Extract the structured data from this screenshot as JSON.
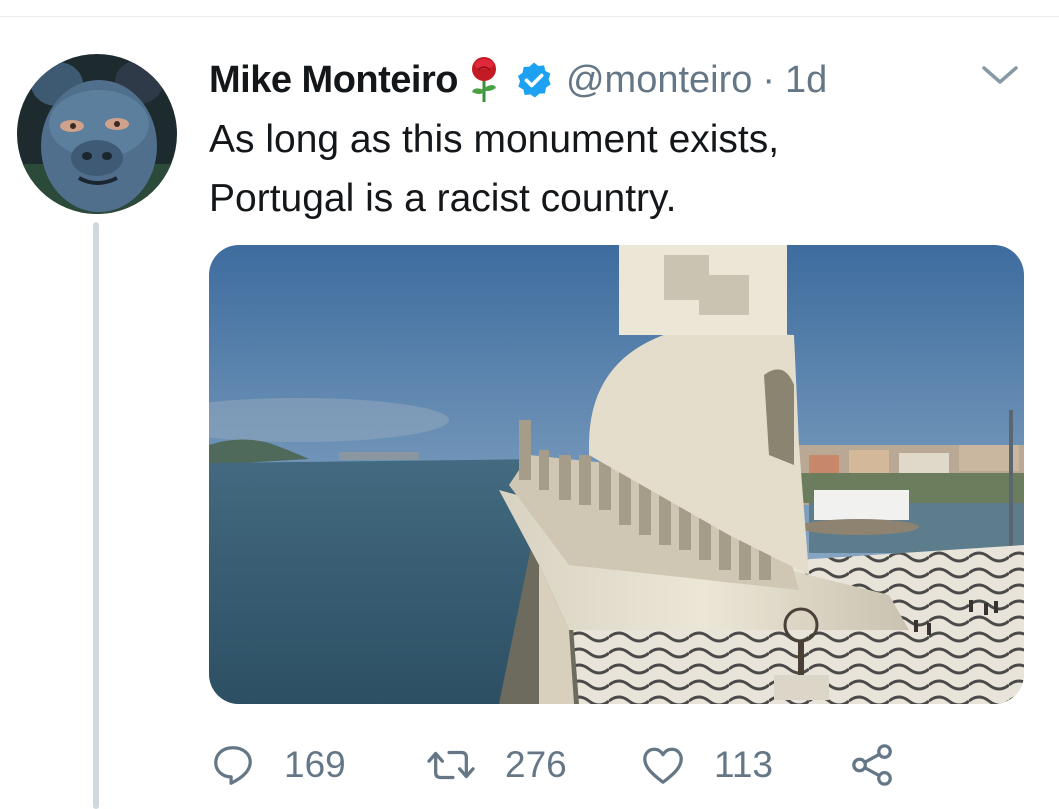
{
  "tweet": {
    "author": {
      "display_name": "Mike Monteiro",
      "emoji": "rose-icon",
      "verified": true,
      "handle": "@monteiro",
      "separator": "·",
      "time": "1d"
    },
    "text_lines": [
      "As long as this monument exists,",
      "Portugal is a racist country."
    ],
    "media": {
      "type": "photo",
      "subject": "monument on riverfront"
    },
    "stats": {
      "replies": "169",
      "retweets": "276",
      "likes": "113"
    },
    "icons": [
      "reply-icon",
      "retweet-icon",
      "like-icon",
      "share-icon",
      "chevron-down-icon",
      "verified-badge-icon"
    ]
  },
  "colors": {
    "text_primary": "#14171a",
    "text_secondary": "#657786",
    "verified_blue": "#1da1f2",
    "thread_line": "#cfd9de"
  }
}
